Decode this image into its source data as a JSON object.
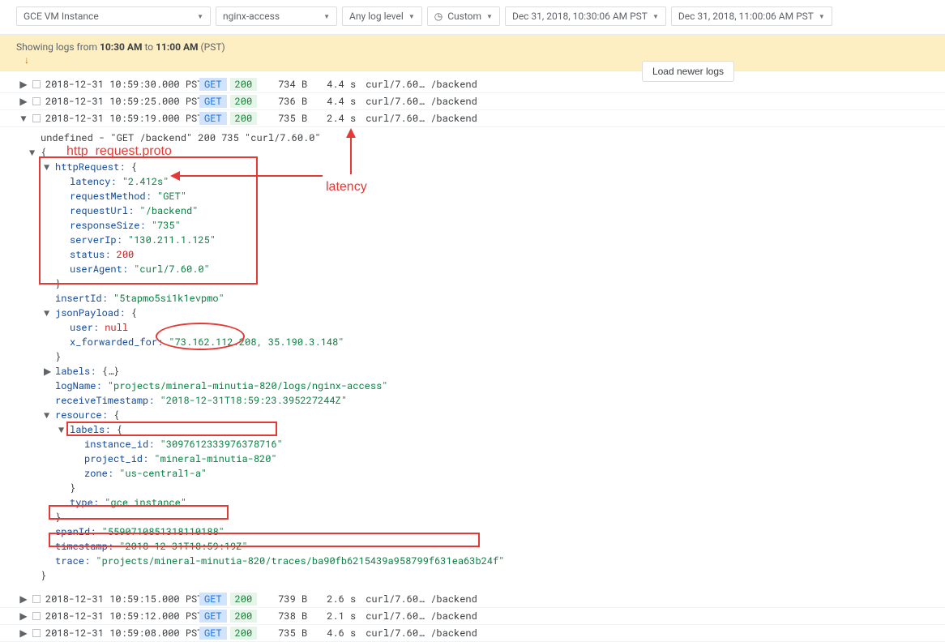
{
  "toolbar": {
    "resource": "GCE VM Instance",
    "log": "nginx-access",
    "level": "Any log level",
    "range": "Custom",
    "start": "Dec 31, 2018, 10:30:06 AM PST",
    "end": "Dec 31, 2018, 11:00:06 AM PST"
  },
  "banner": {
    "prefix": "Showing logs from ",
    "start": "10:30 AM",
    "mid": " to ",
    "end": "11:00 AM",
    "tz": " (PST)",
    "load_label": "Load newer logs"
  },
  "rows": [
    {
      "exp": "▶",
      "ts": "2018-12-31 10:59:30.000 PST",
      "method": "GET",
      "status": "200",
      "size": "734 B",
      "lat": "4.4 s",
      "ua": "curl/7.60…",
      "path": "/backend"
    },
    {
      "exp": "▶",
      "ts": "2018-12-31 10:59:25.000 PST",
      "method": "GET",
      "status": "200",
      "size": "736 B",
      "lat": "4.4 s",
      "ua": "curl/7.60…",
      "path": "/backend"
    },
    {
      "exp": "▼",
      "ts": "2018-12-31 10:59:19.000 PST",
      "method": "GET",
      "status": "200",
      "size": "735 B",
      "lat": "2.4 s",
      "ua": "curl/7.60…",
      "path": "/backend"
    }
  ],
  "rows2": [
    {
      "exp": "▶",
      "ts": "2018-12-31 10:59:15.000 PST",
      "method": "GET",
      "status": "200",
      "size": "739 B",
      "lat": "2.6 s",
      "ua": "curl/7.60…",
      "path": "/backend"
    },
    {
      "exp": "▶",
      "ts": "2018-12-31 10:59:12.000 PST",
      "method": "GET",
      "status": "200",
      "size": "738 B",
      "lat": "2.1 s",
      "ua": "curl/7.60…",
      "path": "/backend"
    },
    {
      "exp": "▶",
      "ts": "2018-12-31 10:59:08.000 PST",
      "method": "GET",
      "status": "200",
      "size": "735 B",
      "lat": "4.6 s",
      "ua": "curl/7.60…",
      "path": "/backend"
    }
  ],
  "detail": {
    "summary": "undefined - \"GET /backend\" 200 735 \"curl/7.60.0\"",
    "open_brace": "{",
    "httpRequest_key": "httpRequest:",
    "httpRequest": {
      "latency_k": "latency:",
      "latency_v": "\"2.412s\"",
      "method_k": "requestMethod:",
      "method_v": "\"GET\"",
      "url_k": "requestUrl:",
      "url_v": "\"/backend\"",
      "size_k": "responseSize:",
      "size_v": "\"735\"",
      "server_k": "serverIp:",
      "server_v": "\"130.211.1.125\"",
      "status_k": "status:",
      "status_v": "200",
      "ua_k": "userAgent:",
      "ua_v": "\"curl/7.60.0\""
    },
    "insertId_k": "insertId:",
    "insertId_v": "\"5tapmo5si1k1evpmo\"",
    "jsonPayload_key": "jsonPayload:",
    "jsonPayload": {
      "user_k": "user:",
      "user_v": "null",
      "xff_k": "x_forwarded_for:",
      "xff_v": "\"73.162.112.208, 35.190.3.148\""
    },
    "labels_k": "labels:",
    "labels_v": "{…}",
    "logName_k": "logName:",
    "logName_v": "\"projects/mineral-minutia-820/logs/nginx-access\"",
    "recvTs_k": "receiveTimestamp:",
    "recvTs_v": "\"2018-12-31T18:59:23.395227244Z\"",
    "resource_k": "resource:",
    "resource": {
      "labels_k": "labels:",
      "instance_k": "instance_id:",
      "instance_v": "\"3097612333976378716\"",
      "project_k": "project_id:",
      "project_v": "\"mineral-minutia-820\"",
      "zone_k": "zone:",
      "zone_v": "\"us-central1-a\"",
      "type_k": "type:",
      "type_v": "\"gce_instance\""
    },
    "spanId_k": "spanId:",
    "spanId_v": "\"5590710851318110188\"",
    "timestamp_k": "timestamp:",
    "timestamp_v": "\"2018-12-31T18:59:19Z\"",
    "trace_k": "trace:",
    "trace_v": "\"projects/mineral-minutia-820/traces/ba90fb6215439a958799f631ea63b24f\"",
    "close_brace": "}"
  },
  "anno": {
    "proto": "http_request.proto",
    "latency": "latency"
  }
}
